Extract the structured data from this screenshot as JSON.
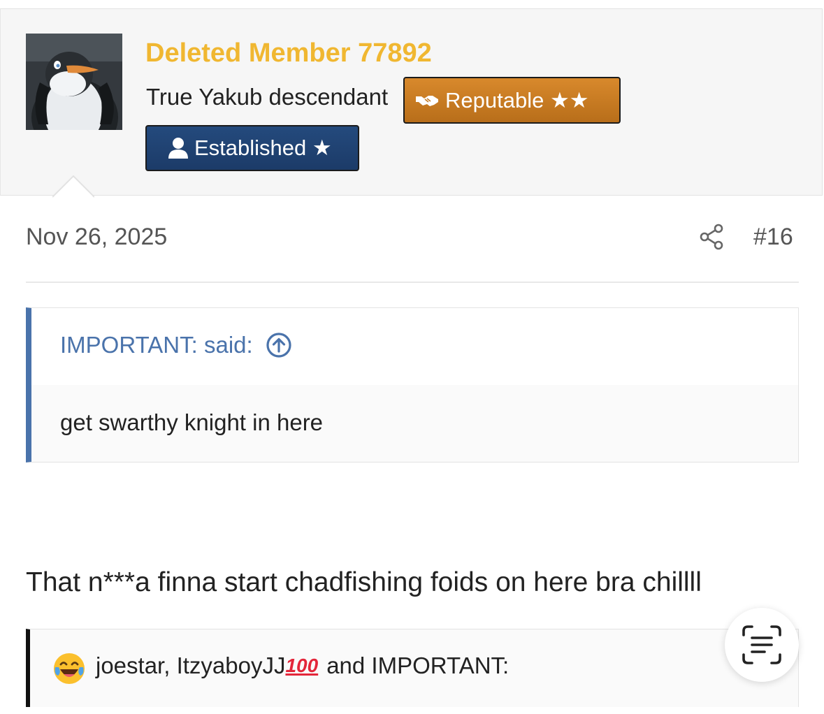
{
  "user": {
    "name": "Deleted Member 77892",
    "title": "True Yakub descendant",
    "badges": [
      {
        "label": "Reputable ★★",
        "icon": "handshake-icon",
        "color": "#c47a22"
      },
      {
        "label": "Established ★",
        "icon": "user-icon",
        "color": "#1f4272"
      }
    ],
    "name_color": "#f0b731"
  },
  "post": {
    "date": "Nov 26, 2025",
    "number": "#16",
    "share_icon": "share-icon"
  },
  "quote": {
    "attribution": "IMPORTANT: said:",
    "attribution_icon": "arrow-up-circle-icon",
    "text": "get swarthy knight in here",
    "accent_color": "#4a73ab"
  },
  "message": {
    "text": "That n***a finna start chadfishing foids on here bra chillll"
  },
  "reactions": {
    "emoji": "laughing-crying-emoji",
    "users_part1": "joestar, ItzyaboyJJ",
    "hundred_emoji": "100",
    "users_part2": "and IMPORTANT:"
  },
  "fab": {
    "icon": "text-scan-icon"
  }
}
